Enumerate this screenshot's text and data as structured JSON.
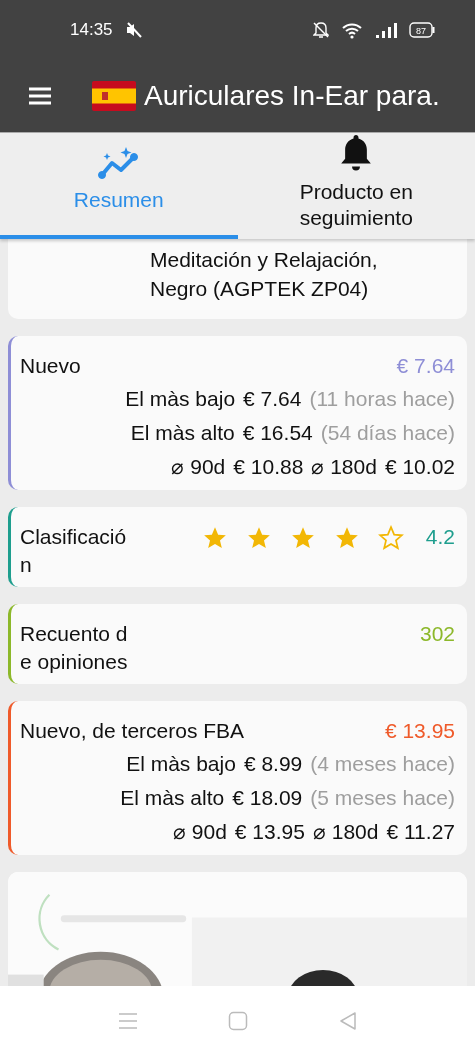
{
  "status_bar": {
    "time": "14:35",
    "battery": "87"
  },
  "app_bar": {
    "title": "Auriculares In-Ear para."
  },
  "tabs": [
    {
      "label": "Resumen",
      "kind": "trend",
      "selected": true
    },
    {
      "label": "Producto en seguimiento",
      "kind": "bell",
      "selected": false
    }
  ],
  "product_title": {
    "lines": [
      "Meditación y Relajación,",
      "Negro (AGPTEK ZP04)"
    ]
  },
  "cards": [
    {
      "kind": "price",
      "label": "Nuevo",
      "value": "€ 7.64",
      "color": "#8e8ed6",
      "lowest": {
        "label": "El màs bajo",
        "price": "€ 7.64",
        "ago": "(11 horas hace)"
      },
      "highest": {
        "label": "El màs alto",
        "price": "€ 16.54",
        "ago": "(54 días hace)"
      },
      "averages": [
        {
          "period": "⌀ 90d",
          "price": "€ 10.88"
        },
        {
          "period": "⌀ 180d",
          "price": "€ 10.02"
        }
      ]
    },
    {
      "kind": "rating",
      "label": "Clasificación",
      "value": "4.2",
      "color": "#1e9e8e",
      "stars": 4
    },
    {
      "kind": "count",
      "label": "Recuento de opiniones",
      "value": "302",
      "color": "#8cb82a"
    },
    {
      "kind": "price",
      "label": "Nuevo, de terceros FBA",
      "value": "€ 13.95",
      "color": "#ef5a2a",
      "lowest": {
        "label": "El màs bajo",
        "price": "€ 8.99",
        "ago": "(4 meses hace)"
      },
      "highest": {
        "label": "El màs alto",
        "price": "€ 18.09",
        "ago": "(5 meses hace)"
      },
      "averages": [
        {
          "period": "⌀ 90d",
          "price": "€ 13.95"
        },
        {
          "period": "⌀ 180d",
          "price": "€ 11.27"
        }
      ]
    }
  ]
}
